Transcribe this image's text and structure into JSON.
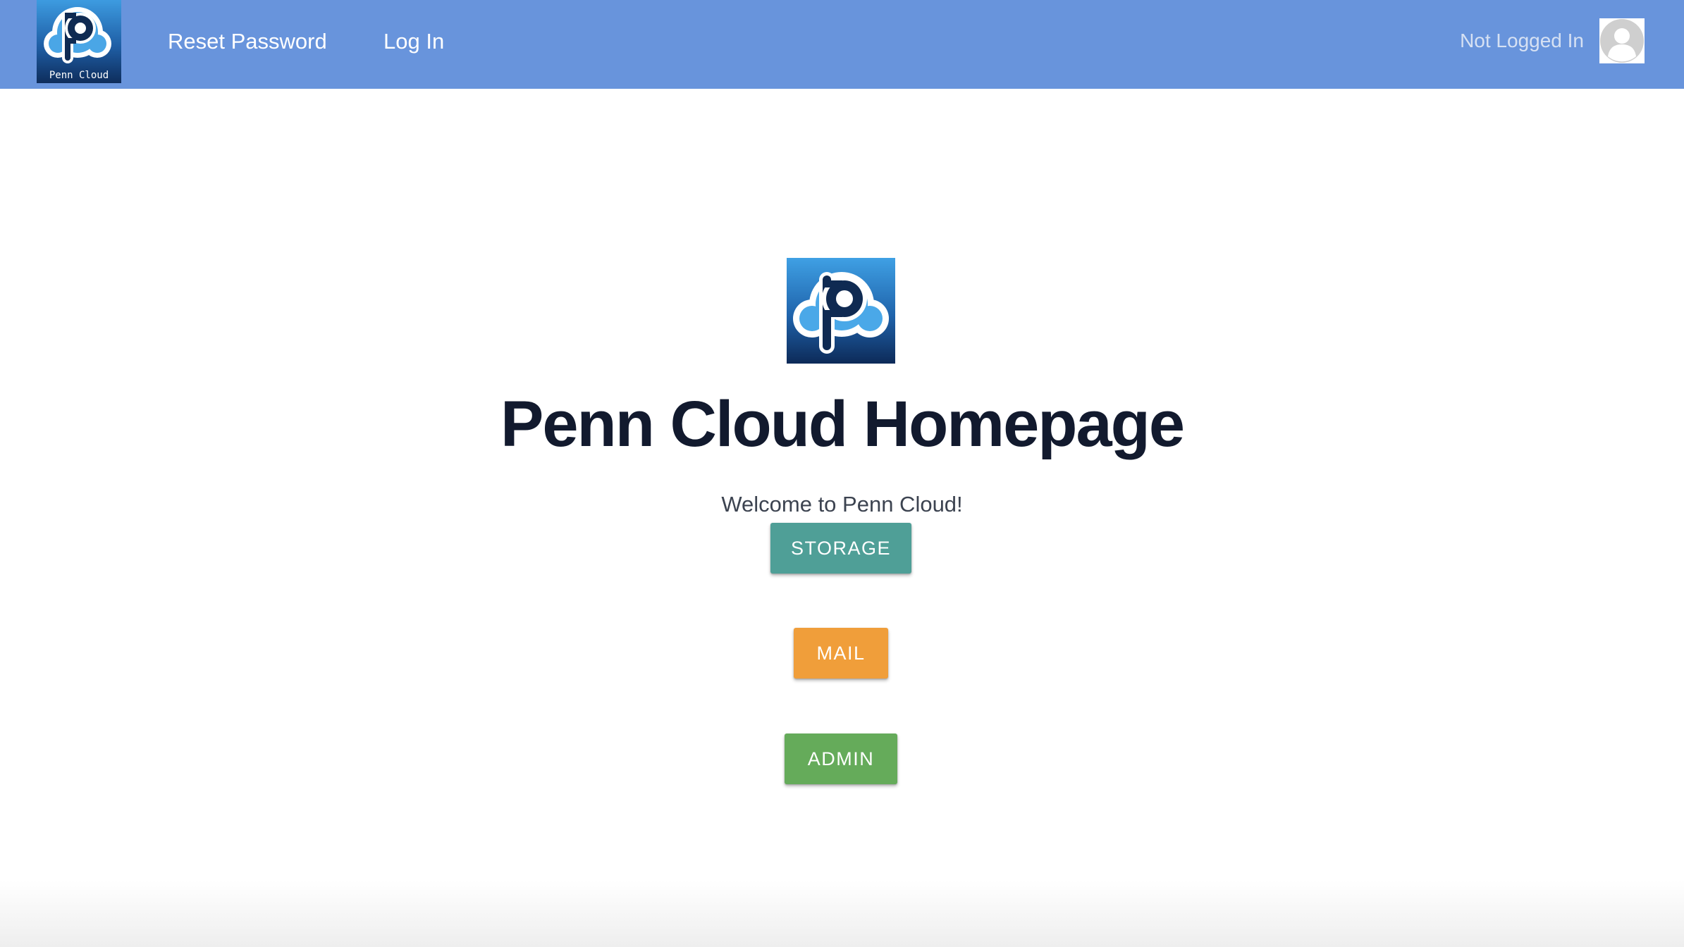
{
  "navbar": {
    "logo_caption": "Penn Cloud",
    "links": [
      {
        "label": "Reset Password"
      },
      {
        "label": "Log In"
      }
    ],
    "status_text": "Not Logged In"
  },
  "main": {
    "title": "Penn Cloud Homepage",
    "welcome": "Welcome to Penn Cloud!",
    "buttons": [
      {
        "label": "STORAGE",
        "color": "#4f9f97"
      },
      {
        "label": "MAIL",
        "color": "#f09e3a"
      },
      {
        "label": "ADMIN",
        "color": "#65ab5a"
      }
    ]
  },
  "colors": {
    "navbar": "#6894dc",
    "logo_background": "#1e5aa0",
    "title": "#121a2e"
  },
  "icons": {
    "brand_logo": "penn-cloud-logo-icon",
    "avatar": "user-avatar-icon"
  }
}
